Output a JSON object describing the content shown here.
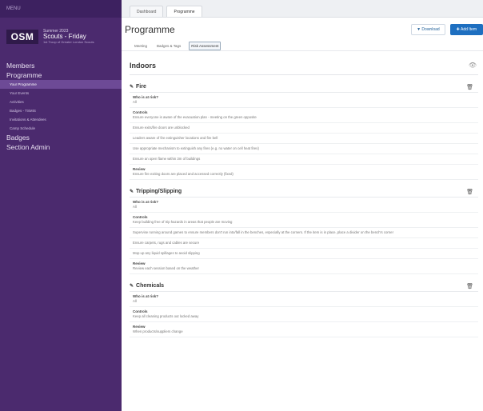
{
  "sidebar": {
    "top_label": "MENU",
    "brand": {
      "logo": "OSM",
      "line1": "Summer 2023",
      "line2": "Scouts - Friday",
      "line3": "1st Troop of Greater London Scouts"
    },
    "items": [
      {
        "label": "Members"
      },
      {
        "label": "Programme"
      }
    ],
    "subitems": [
      {
        "label": "Your Programme"
      },
      {
        "label": "Your Events"
      },
      {
        "label": "Activities"
      },
      {
        "label": "Badges - TSMIS"
      },
      {
        "label": "Invitations & Attendees"
      },
      {
        "label": "Camp Schedule"
      }
    ],
    "items2": [
      {
        "label": "Badges"
      },
      {
        "label": "Section Admin"
      }
    ]
  },
  "tabstrip": {
    "tabs": [
      {
        "label": "Dashboard"
      },
      {
        "label": "Programme"
      }
    ]
  },
  "header": {
    "title": "Programme",
    "download_label": "Download",
    "add_label": "Add Item"
  },
  "subtabs": [
    {
      "label": "Meeting"
    },
    {
      "label": "Badges & Tags"
    },
    {
      "label": "Risk Assessment"
    }
  ],
  "section": {
    "title": "Indoors"
  },
  "hazards": [
    {
      "title": "Fire",
      "who_label": "Who is at risk?",
      "who_value": "All",
      "controls_label": "Controls",
      "controls": [
        "Ensure everyone is aware of the evacuation plan - meeting on the green opposite",
        "Ensure exits/fire doors are unblocked",
        "Leaders aware of fire extinguisher locations and fire bell",
        "Use appropriate mechanism to extinguish any fires (e.g. no water on cell heat fires)",
        "Ensure an open flame within 3m of buildings"
      ],
      "review_label": "Review",
      "review_value": "Ensure fire exiting doors are placed and accessed correctly (fixed)"
    },
    {
      "title": "Tripping/Slipping",
      "who_label": "Who is at risk?",
      "who_value": "All",
      "controls_label": "Controls",
      "controls": [
        "Keep building free of trip hazards in areas that people are moving",
        "Supervise running around games to ensure members don't run into/fall in the benches, especially at the corners. If the item is in place, place a divider on the bench's corner",
        "Ensure carpets, rugs and cables are secure",
        "Mop up any liquid spillages to avoid slipping"
      ],
      "review_label": "Review",
      "review_value": "Review each session based on the weather"
    },
    {
      "title": "Chemicals",
      "who_label": "Who is at risk?",
      "who_value": "All",
      "controls_label": "Controls",
      "controls": [],
      "controls_value": "Keep all cleaning products out locked away",
      "review_label": "Review",
      "review_value": "When products/suppliers change"
    }
  ]
}
